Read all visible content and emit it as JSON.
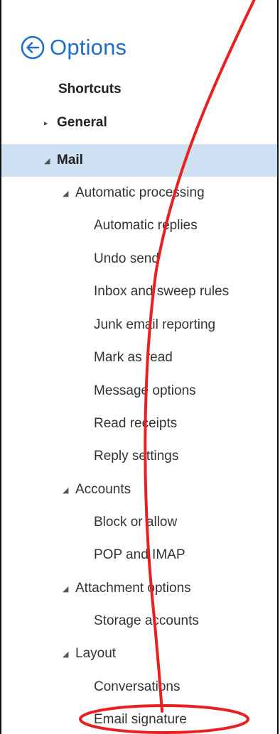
{
  "header": {
    "title": "Options",
    "back_icon": "back-arrow-circle-icon",
    "accent_color": "#1f6fcd"
  },
  "nav": {
    "selected_background": "#cde1f2",
    "items": [
      {
        "label": "Shortcuts"
      },
      {
        "label": "General",
        "expander": "▸"
      },
      {
        "label": "Mail",
        "expander": "◢"
      },
      {
        "label": "Automatic processing",
        "expander": "◢"
      },
      {
        "label": "Automatic replies"
      },
      {
        "label": "Undo send"
      },
      {
        "label": "Inbox and sweep rules"
      },
      {
        "label": "Junk email reporting"
      },
      {
        "label": "Mark as read"
      },
      {
        "label": "Message options"
      },
      {
        "label": "Read receipts"
      },
      {
        "label": "Reply settings"
      },
      {
        "label": "Accounts",
        "expander": "◢"
      },
      {
        "label": "Block or allow"
      },
      {
        "label": "POP and IMAP"
      },
      {
        "label": "Attachment options",
        "expander": "◢"
      },
      {
        "label": "Storage accounts"
      },
      {
        "label": "Layout",
        "expander": "◢"
      },
      {
        "label": "Conversations"
      },
      {
        "label": "Email signature"
      }
    ]
  },
  "annotation": {
    "color": "#e8201f",
    "highlighted_item": "Email signature"
  }
}
